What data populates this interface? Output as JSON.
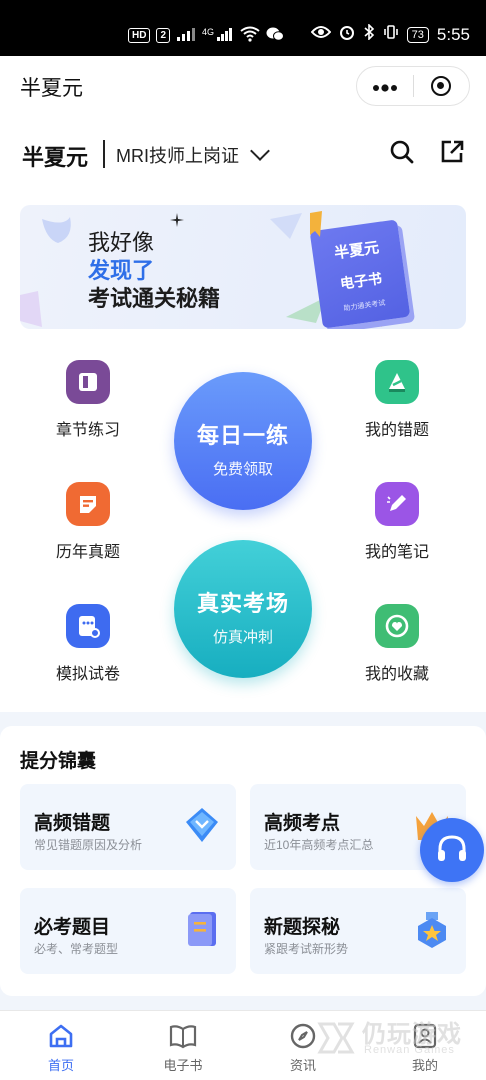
{
  "status_bar": {
    "left_badges": [
      "HD",
      "2",
      "4G"
    ],
    "battery": "73",
    "time": "5:55"
  },
  "title_bar": {
    "title": "半夏元",
    "more_icon": "ellipsis-icon",
    "close_icon": "target-icon"
  },
  "header": {
    "brand": "半夏元",
    "exam": "MRI技师上岗证"
  },
  "banner": {
    "line1": "我好像",
    "line2": "发现了",
    "line3": "考试通关秘籍",
    "book_title": "半夏元",
    "book_subtitle": "电子书",
    "book_caption": "助力通关考试"
  },
  "features": {
    "chapter": "章节练习",
    "past": "历年真题",
    "mock": "模拟试卷",
    "wrong": "我的错题",
    "notes": "我的笔记",
    "fav": "我的收藏"
  },
  "daily": {
    "title": "每日一练",
    "sub": "免费领取"
  },
  "exam_room": {
    "title": "真实考场",
    "sub": "仿真冲刺"
  },
  "tips": {
    "title": "提分锦囊",
    "tiles": [
      {
        "title": "高频错题",
        "sub": "常见错题原因及分析"
      },
      {
        "title": "高频考点",
        "sub": "近10年高频考点汇总"
      },
      {
        "title": "必考题目",
        "sub": "必考、常考题型"
      },
      {
        "title": "新题探秘",
        "sub": "紧跟考试新形势"
      }
    ]
  },
  "tabs": [
    {
      "label": "首页",
      "icon": "home-icon",
      "active": true
    },
    {
      "label": "电子书",
      "icon": "book-icon",
      "active": false
    },
    {
      "label": "资讯",
      "icon": "compass-icon",
      "active": false
    },
    {
      "label": "我的",
      "icon": "profile-icon",
      "active": false
    }
  ],
  "watermark": {
    "name": "仍玩游戏",
    "sub": "Renwan Games"
  },
  "colors": {
    "accent": "#3d6ef2",
    "daily_gradient": [
      "#6a9bfb",
      "#4a6ef3"
    ],
    "exam_gradient": [
      "#43d0d8",
      "#17aec0"
    ]
  }
}
